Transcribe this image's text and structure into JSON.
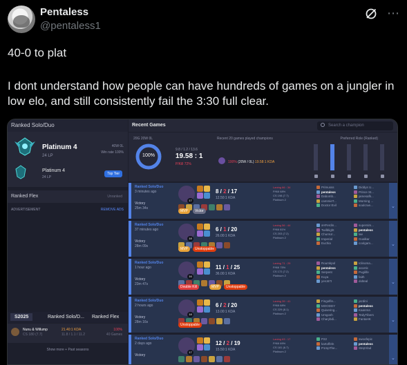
{
  "tweet": {
    "display_name": "Pentaless",
    "handle": "@pentaless1",
    "line1": "40-0 to plat",
    "line2": "I dont understand how people can have hundreds of games on a jungler in low elo, and still consistently fail the 3:30 full clear."
  },
  "sidebar": {
    "solo_title": "Ranked Solo/Duo",
    "tier": "Platinum 4",
    "lp": "24 LP",
    "wl": "40W 0L",
    "winrate": "Win rate 100%",
    "tier2": "Platinum 4",
    "lp2": "24 LP",
    "top_tier": "Top Tier",
    "flex_title": "Ranked Flex",
    "flex_status": "Unranked",
    "advertisement": "ADVERTISEMENT",
    "remove_ads": "REMOVE ADS",
    "season_tab": "S2025",
    "season_solo": "Ranked Solo/D...",
    "season_flex": "Ranked Flex",
    "champ_name": "Nunu & Willump",
    "champ_kda": "21.40:1 KDA",
    "champ_cs": "CS 180 (7.7)",
    "champ_ratio": "11.8 / 1.1 / 11.2",
    "champ_wr": "100%",
    "champ_games": "40 Games",
    "show_more": "Show more + Past seasons"
  },
  "recent": {
    "title": "Recent Games",
    "search_placeholder": "Search a champion",
    "record": "20G 20W 0L",
    "winrate_pct": "100%",
    "kda_components": "9.8 / 1.2 / 13.6",
    "kda": "19.58 : 1",
    "kill_participation": "P/Kill 72%",
    "played_label": "Recent 20 games played champions",
    "played_wr": "100%",
    "played_wl": "(20W / 0L)",
    "played_kda": "19.58:1 KDA",
    "role_label": "Preferred Role (Ranked)",
    "roles": [
      {
        "name": "Top",
        "fraction": 0.0
      },
      {
        "name": "Jungle",
        "fraction": 1.0
      },
      {
        "name": "Mid",
        "fraction": 0.0
      },
      {
        "name": "Bot",
        "fraction": 0.0
      },
      {
        "name": "Support",
        "fraction": 0.0
      }
    ]
  },
  "matches": [
    {
      "queue": "Ranked Solo/Duo",
      "ago": "3 minutes ago",
      "result": "Victory",
      "duration": "25m 34s",
      "level": "17",
      "kills": "8",
      "deaths": "2",
      "assists": "17",
      "kda": "12.50:1 KDA",
      "stats": [
        "Laning 66 : 34",
        "P/Kill 68%",
        "CS 198 (7.7)",
        "Platinum 2"
      ],
      "badges": [
        {
          "text": "MVP",
          "color": "#e8a33a"
        },
        {
          "text": "Victor",
          "color": "#6b6f86"
        }
      ],
      "team1": [
        "Primusss",
        "pentaless",
        "Dabomb...",
        "cammieT...",
        "Doctor Evil"
      ],
      "team2": [
        "Diddys U...",
        "Prince St...",
        "jamesafk...",
        "Morning ...",
        "soulcrue..."
      ]
    },
    {
      "queue": "Ranked Solo/Duo",
      "ago": "37 minutes ago",
      "result": "Victory",
      "duration": "28m 09s",
      "level": "18",
      "kills": "6",
      "deaths": "1",
      "assists": "20",
      "kda": "26.00:1 KDA",
      "stats": [
        "Laning 56 : 44",
        "P/Kill 81%",
        "CS 203 (7.2)",
        "Platinum 2"
      ],
      "badges": [
        {
          "text": "MVP",
          "color": "#e8a33a"
        },
        {
          "text": "Unstoppable",
          "color": "#e03d0f"
        }
      ],
      "team1": [
        "xHFerdin...",
        "Twilblight",
        "ChumUr...",
        "Imperial",
        "Euchia"
      ],
      "team2": [
        "supersim...",
        "pentaless",
        "lae",
        "Goalkar",
        "coolgam..."
      ]
    },
    {
      "queue": "Ranked Solo/Duo",
      "ago": "1 hour ago",
      "result": "Victory",
      "duration": "23m 47s",
      "level": "16",
      "kills": "11",
      "deaths": "1",
      "assists": "25",
      "kda": "36.00:1 KDA",
      "stats": [
        "Laning 71 : 29",
        "P/Kill 75%",
        "CS 172 (7.2)",
        "Platinum 2"
      ],
      "badges": [
        {
          "text": "Double Kill",
          "color": "#e03d3d"
        },
        {
          "text": "MVP",
          "color": "#e8a33a"
        },
        {
          "text": "Unstoppable",
          "color": "#e03d0f"
        }
      ],
      "team1": [
        "Roumkpol",
        "pentaless",
        "Serpent",
        "Kuya",
        "yero57t"
      ],
      "team2": [
        "Iclinoma...",
        "ascetic",
        "Pugilife",
        "faith",
        "dolteal"
      ]
    },
    {
      "queue": "Ranked Solo/Duo",
      "ago": "2 hours ago",
      "result": "Victory",
      "duration": "28m 16s",
      "level": "18",
      "kills": "6",
      "deaths": "2",
      "assists": "20",
      "kda": "13.00:1 KDA",
      "stats": [
        "Laning 39 : 41",
        "P/Kill 68%",
        "CS 229 (8.1)",
        "Platinum 2"
      ],
      "badges": [
        {
          "text": "Unstoppable",
          "color": "#e03d0f"
        }
      ],
      "team1": [
        "Fingolfin...",
        "MOODDY",
        "Quivering...",
        "Umgosh",
        "Charybdi..."
      ],
      "team2": [
        "jazdini",
        "pentaless",
        "Kaanma",
        "TedyTibers",
        "FantaHK"
      ]
    },
    {
      "queue": "Ranked Solo/Duo",
      "ago": "2 days ago",
      "result": "Victory",
      "duration": "",
      "level": "17",
      "kills": "12",
      "deaths": "2",
      "assists": "19",
      "kda": "15.50:1 KDA",
      "stats": [
        "Laning 63 : 17",
        "P/Kill 69%",
        "CS 181 (6.7)",
        "Platinum 2"
      ],
      "badges": [],
      "team1": [
        "P22",
        "kartoffeln",
        "P1mpThe...",
        "",
        ""
      ],
      "team2": [
        "swoofepic",
        "pentaless",
        "StepVlad",
        "",
        ""
      ]
    }
  ]
}
